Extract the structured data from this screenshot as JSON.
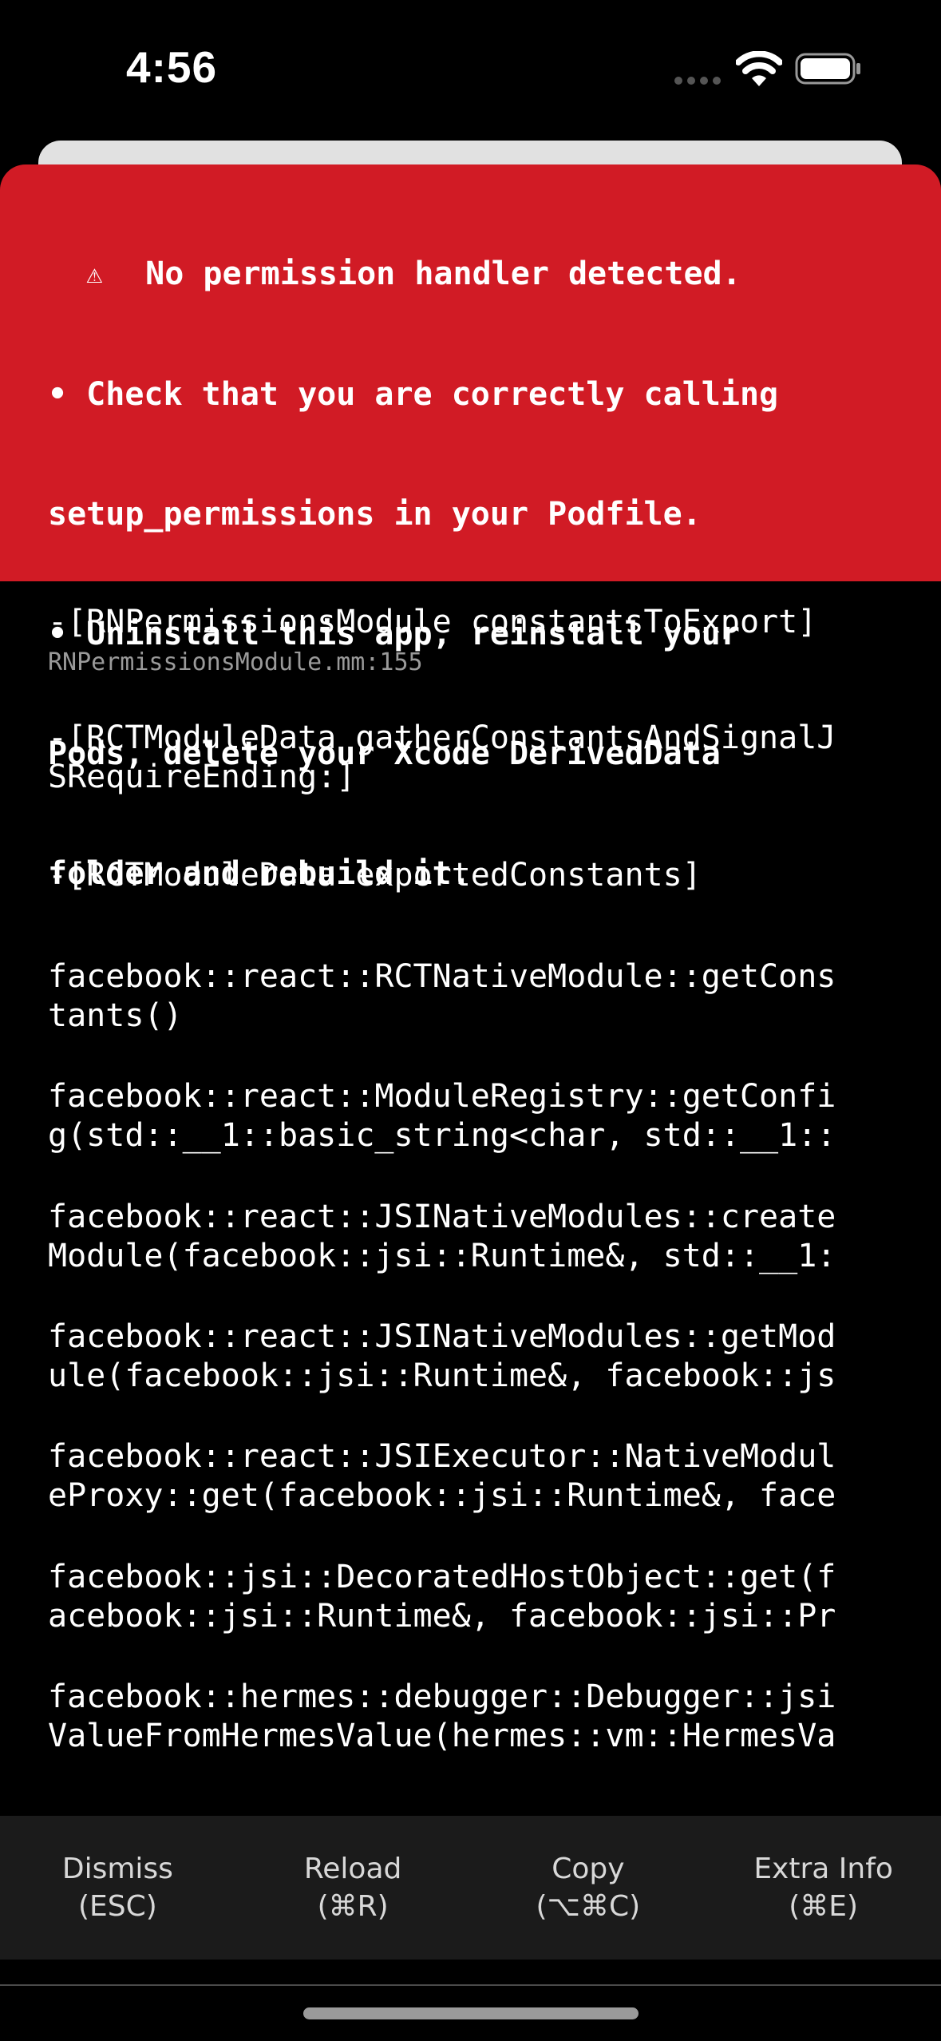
{
  "status_bar": {
    "time": "4:56",
    "icons": [
      "cellular-dots-icon",
      "wifi-icon",
      "battery-icon"
    ]
  },
  "error": {
    "warning_icon": "⚠",
    "title": "No permission handler detected.",
    "hints": [
      "• Check that you are correctly calling",
      "setup_permissions in your Podfile.",
      "• Uninstall this app, reinstall your",
      "Pods, delete your Xcode DerivedData",
      "folder and rebuild it."
    ],
    "header_color": "#d11b25"
  },
  "stack": [
    {
      "lines": [
        "-[RNPermissionsModule constantsToExport]"
      ],
      "file": "RNPermissionsModule.mm:155"
    },
    {
      "lines": [
        "-[RCTModuleData gatherConstantsAndSignalJ",
        "SRequireEnding:]"
      ]
    },
    {
      "lines": [
        "-[RCTModuleData exportedConstants]"
      ]
    },
    {
      "lines": [
        "facebook::react::RCTNativeModule::getCons",
        "tants()"
      ]
    },
    {
      "lines": [
        "facebook::react::ModuleRegistry::getConfi",
        "g(std::__1::basic_string<char, std::__1::"
      ]
    },
    {
      "lines": [
        "facebook::react::JSINativeModules::create",
        "Module(facebook::jsi::Runtime&, std::__1:"
      ]
    },
    {
      "lines": [
        "facebook::react::JSINativeModules::getMod",
        "ule(facebook::jsi::Runtime&, facebook::js"
      ]
    },
    {
      "lines": [
        "facebook::react::JSIExecutor::NativeModul",
        "eProxy::get(facebook::jsi::Runtime&, face"
      ]
    },
    {
      "lines": [
        "facebook::jsi::DecoratedHostObject::get(f",
        "acebook::jsi::Runtime&, facebook::jsi::Pr"
      ]
    },
    {
      "lines": [
        "facebook::hermes::debugger::Debugger::jsi",
        "ValueFromHermesValue(hermes::vm::HermesVa"
      ]
    }
  ],
  "toolbar": [
    {
      "label": "Dismiss",
      "shortcut": "(ESC)"
    },
    {
      "label": "Reload",
      "shortcut": "(⌘R)"
    },
    {
      "label": "Copy",
      "shortcut": "(⌥⌘C)"
    },
    {
      "label": "Extra Info",
      "shortcut": "(⌘E)"
    }
  ]
}
